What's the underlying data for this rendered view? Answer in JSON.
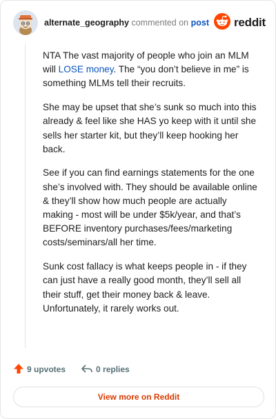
{
  "header": {
    "username": "alternate_geography",
    "commented_on": "commented on",
    "post_link": "post",
    "brand": "reddit",
    "avatar_icon": "snoo-avatar-icon",
    "brand_icon": "reddit-logo-icon",
    "brand_color": "#ff4500"
  },
  "comment": {
    "p1_a": "NTA The vast majority of people who join an MLM will ",
    "p1_link": "LOSE money",
    "p1_b": ". The “you don’t believe in me” is something MLMs tell their recruits.",
    "p2": "She may be upset that she’s sunk so much into this already & feel like she HAS yo keep with it until she sells her starter kit, but they’ll keep hooking her back.",
    "p3": "See if you can find earnings statements for the one she’s involved with. They should be available online & they’ll show how much people are actually making - most will be under $5k/year, and that’s BEFORE inventory purchases/fees/marketing costs/seminars/all her time.",
    "p4": "Sunk cost fallacy is what keeps people in - if they can just have a really good month, they’ll sell all their stuff, get their money back & leave. Unfortunately, it rarely works out."
  },
  "actions": {
    "upvotes": "9 upvotes",
    "replies": "0 replies",
    "upvote_icon": "upvote-arrow-icon",
    "reply_icon": "reply-arrow-icon",
    "upvote_color": "#ff4500"
  },
  "footer": {
    "view_more": "View more on Reddit",
    "accent": "#d93a00"
  }
}
